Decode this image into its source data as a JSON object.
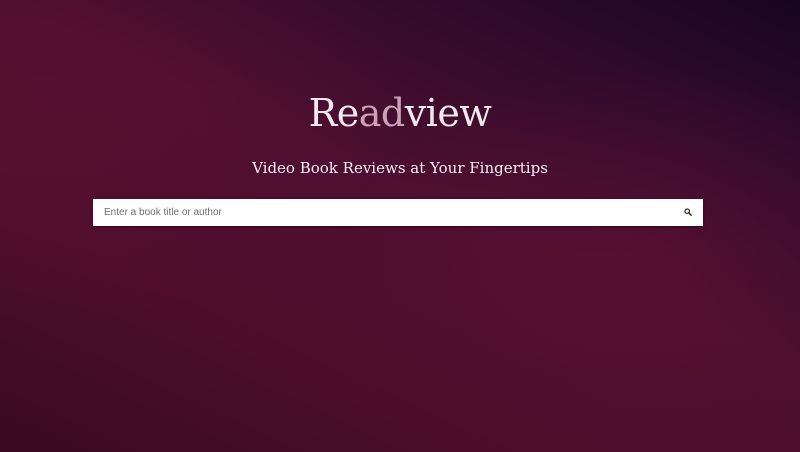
{
  "hero": {
    "logo": {
      "part1": "Re",
      "accent": "ad",
      "part2": "view"
    },
    "tagline": "Video Book Reviews at Your Fingertips"
  },
  "search": {
    "placeholder": "Enter a book title or author",
    "value": "",
    "icon": "search-icon"
  },
  "colors": {
    "logo_text": "#f3e9ee",
    "logo_accent": "#c9a3b8",
    "background_dark": "#17061f",
    "background_main": "#4d0f30"
  }
}
